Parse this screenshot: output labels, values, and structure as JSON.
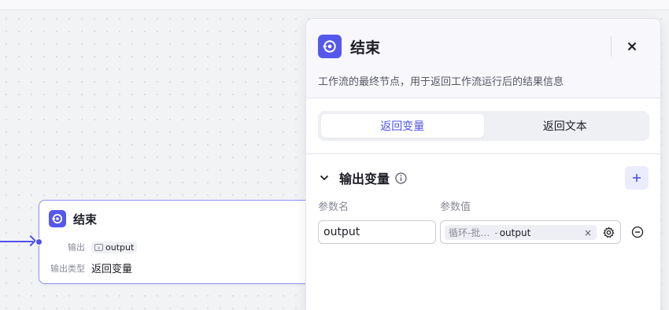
{
  "canvas": {
    "end_node": {
      "title": "结束",
      "output_label": "输出",
      "output_var": "output",
      "output_type_label": "输出类型",
      "output_type_value": "返回变量"
    }
  },
  "panel": {
    "title": "结束",
    "description": "工作流的最终节点，用于返回工作流运行后的结果信息",
    "close_icon": "close-icon",
    "tabs": [
      {
        "label": "返回变量",
        "active": true
      },
      {
        "label": "返回文本",
        "active": false
      }
    ],
    "section": {
      "title": "输出变量",
      "col_name_label": "参数名",
      "col_value_label": "参数值",
      "rows": [
        {
          "name": "output",
          "ref_source": "循环-批…",
          "ref_sep": "-",
          "ref_var": "output",
          "clear": "×"
        }
      ]
    }
  },
  "colors": {
    "accent": "#4e53e8",
    "icon_bg": "#5558ea",
    "canvas_bg": "#f2f3f5"
  }
}
